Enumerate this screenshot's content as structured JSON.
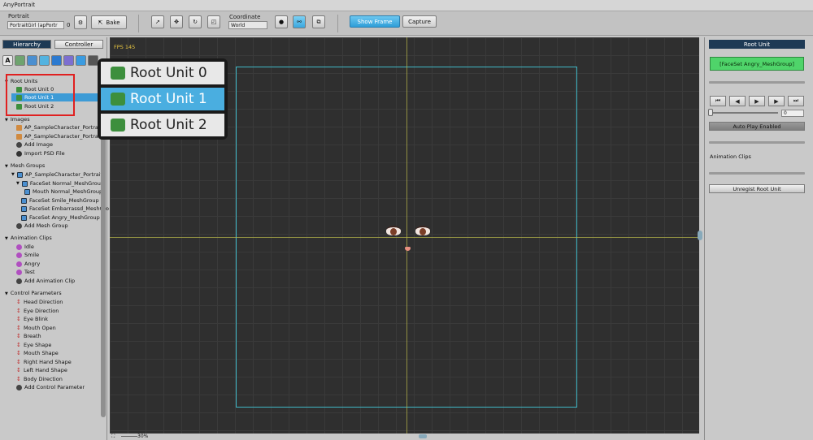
{
  "window": {
    "title": "AnyPortrait"
  },
  "toolbar": {
    "portrait_label": "Portrait",
    "portrait_value": "PortraitGirl (apPortr",
    "portrait_suffix": "0",
    "bake_label": "Bake",
    "coordinate_label": "Coordinate",
    "coordinate_value": "World",
    "show_frame_label": "Show Frame",
    "capture_label": "Capture"
  },
  "left_panel": {
    "tabs": [
      {
        "label": "Hierarchy"
      },
      {
        "label": "Controller"
      }
    ],
    "filter_a_label": "A",
    "sections": {
      "root_units": {
        "label": "Root Units",
        "items": [
          {
            "label": "Root Unit 0"
          },
          {
            "label": "Root Unit 1"
          },
          {
            "label": "Root Unit 2"
          }
        ],
        "selected_index": 1
      },
      "images": {
        "label": "Images",
        "items": [
          {
            "label": "AP_SampleCharacter_Portrait"
          },
          {
            "label": "AP_SampleCharacter_Portrait"
          },
          {
            "label": "Add Image"
          },
          {
            "label": "Import PSD File"
          }
        ]
      },
      "mesh_groups": {
        "label": "Mesh Groups",
        "items": [
          {
            "label": "AP_SampleCharacter_Portrait"
          },
          {
            "label": "FaceSet Normal_MeshGroup"
          },
          {
            "label": "Mouth Normal_MeshGroup"
          },
          {
            "label": "FaceSet Smile_MeshGroup"
          },
          {
            "label": "FaceSet Embarrassd_MeshGro"
          },
          {
            "label": "FaceSet Angry_MeshGroup"
          },
          {
            "label": "Add Mesh Group"
          }
        ]
      },
      "animation_clips": {
        "label": "Animation Clips",
        "items": [
          {
            "label": "Idle"
          },
          {
            "label": "Smile"
          },
          {
            "label": "Angry"
          },
          {
            "label": "Test"
          },
          {
            "label": "Add Animation Clip"
          }
        ]
      },
      "control_parameters": {
        "label": "Control Parameters",
        "items": [
          {
            "label": "Head Direction"
          },
          {
            "label": "Eye Direction"
          },
          {
            "label": "Eye Blink"
          },
          {
            "label": "Mouth Open"
          },
          {
            "label": "Breath"
          },
          {
            "label": "Eye Shape"
          },
          {
            "label": "Mouth Shape"
          },
          {
            "label": "Right Hand Shape"
          },
          {
            "label": "Left Hand Shape"
          },
          {
            "label": "Body Direction"
          },
          {
            "label": "Add Control Parameter"
          }
        ]
      }
    }
  },
  "canvas": {
    "fps_text": "FPS 145",
    "zoom_text": "30%"
  },
  "right_panel": {
    "title": "Root Unit",
    "mesh_group_button": "[FaceSet Angry_MeshGroup]",
    "frame_value": "0",
    "auto_play_label": "Auto Play Enabled",
    "animation_clips_label": "Animation Clips",
    "unregist_label": "Unregist Root Unit"
  },
  "popup": {
    "items": [
      {
        "label": "Root Unit 0"
      },
      {
        "label": "Root Unit 1"
      },
      {
        "label": "Root Unit 2"
      }
    ],
    "selected_index": 1
  },
  "colors": {
    "selection": "#3d9bd6",
    "highlight_box": "#e02020",
    "frame": "#3fb8c6",
    "green_button": "#4fd46a"
  }
}
